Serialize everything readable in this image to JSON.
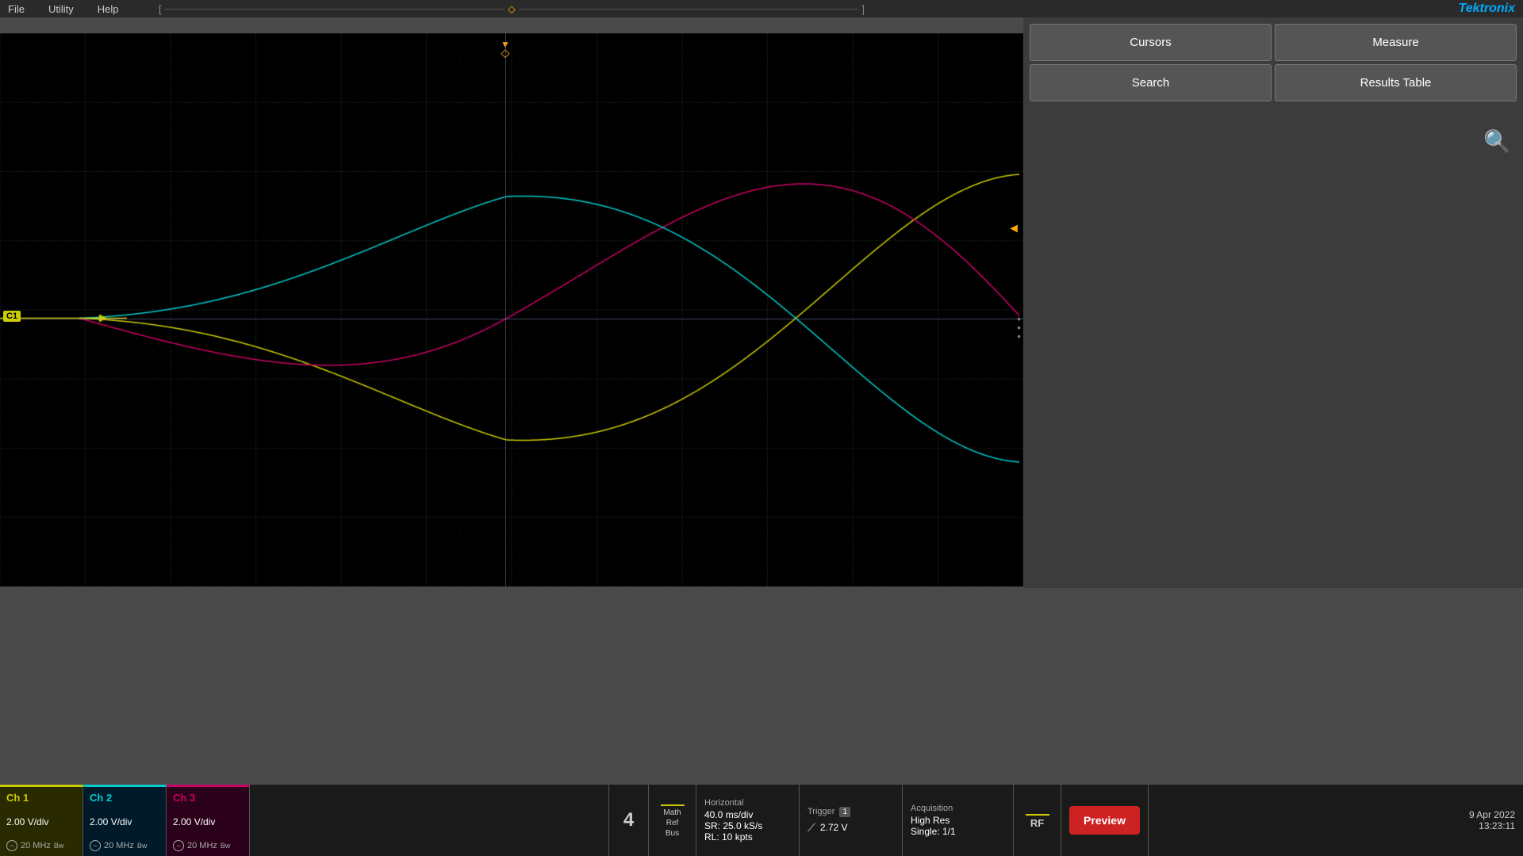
{
  "menu": {
    "file": "File",
    "utility": "Utility",
    "help": "Help"
  },
  "logo": "Tektronix",
  "buttons": {
    "cursors": "Cursors",
    "measure": "Measure",
    "search": "Search",
    "results_table": "Results Table"
  },
  "channels": {
    "ch1": {
      "label": "Ch 1",
      "volts_div": "2.00 V/div",
      "freq": "20 MHz",
      "bw": "BW"
    },
    "ch2": {
      "label": "Ch 2",
      "volts_div": "2.00 V/div",
      "freq": "20 MHz",
      "bw": "BW"
    },
    "ch3": {
      "label": "Ch 3",
      "volts_div": "2.00 V/div",
      "freq": "20 MHz",
      "bw": "BW"
    }
  },
  "math_ref_bus": {
    "label_math": "Math",
    "label_ref": "Ref",
    "label_bus": "Bus"
  },
  "horizontal": {
    "title": "Horizontal",
    "time_div": "40.0 ms/div",
    "sample_rate": "SR: 25.0 kS/s",
    "record_length": "RL: 10 kpts"
  },
  "trigger": {
    "title": "Trigger",
    "channel": "1",
    "voltage": "2.72 V"
  },
  "acquisition": {
    "title": "Acquisition",
    "mode": "High Res",
    "single": "Single: 1/1"
  },
  "number4": "4",
  "rf_label": "RF",
  "preview_button": "Preview",
  "datetime": {
    "date": "9 Apr 2022",
    "time": "13:23:11"
  },
  "c1_label": "C1",
  "trigger_marker": "▼",
  "colors": {
    "ch1": "#cccc00",
    "ch2": "#00cccc",
    "ch3": "#cc0066",
    "accent": "#ffaa00",
    "bg": "#000000",
    "grid": "#1a2a1a"
  }
}
